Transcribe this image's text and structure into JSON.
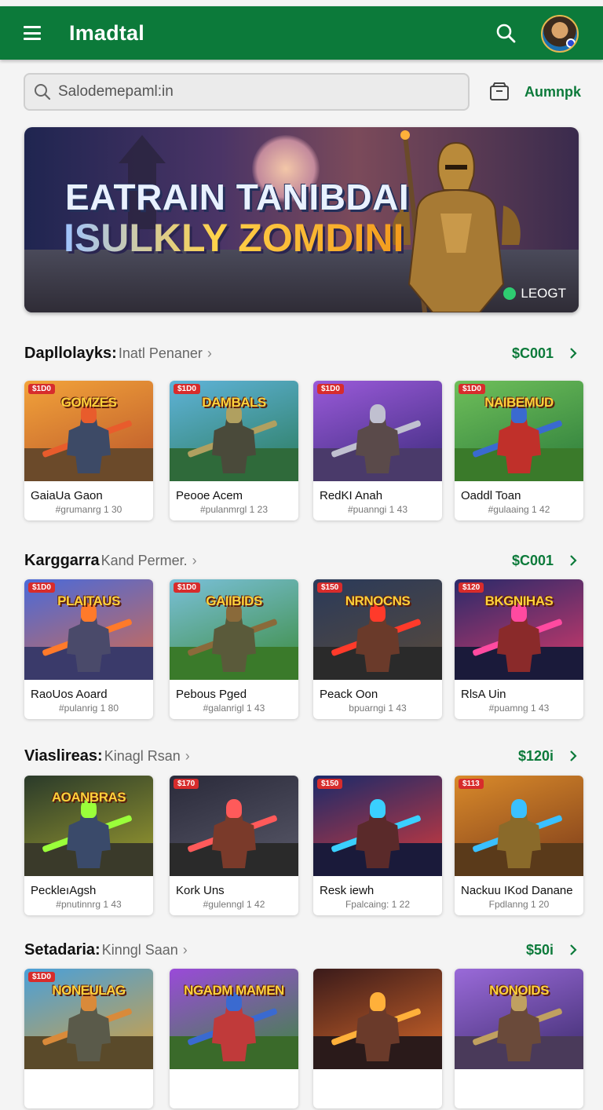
{
  "app": {
    "title": "Imadtal"
  },
  "search": {
    "placeholder": "Salodemepaml:in",
    "action_label": "Aumnpk"
  },
  "banner": {
    "line1": "EATRAIN TANIBDAI",
    "line2": "ISULKLY ZOMDINI",
    "brand": "LEOGT"
  },
  "sections": [
    {
      "title": "Dapllolayks:",
      "subtitle": "Inatl Penaner",
      "price": "$C001",
      "items": [
        {
          "tag": "$1D0",
          "art_title": "GOMZES",
          "name": "GaiaUa Gaon",
          "meta": "#grumanrg 1 30",
          "sky": [
            "#f2a33a",
            "#b9542a"
          ],
          "ground": "#6b4a2a",
          "hero": "#3d4a66",
          "accent": "#e85c2c"
        },
        {
          "tag": "$1D0",
          "art_title": "DAMBALS",
          "name": "Peooe Acem",
          "meta": "#pulanmrgl 1 23",
          "sky": [
            "#5fb3d9",
            "#2a7a5a"
          ],
          "ground": "#2f6a3a",
          "hero": "#4a4a3a",
          "accent": "#b0a060"
        },
        {
          "tag": "$1D0",
          "art_title": "",
          "name": "RedKI Anah",
          "meta": "#puanngi 1 43",
          "sky": [
            "#9a5ad9",
            "#3a2a7a"
          ],
          "ground": "#4a3a6a",
          "hero": "#5a4a4a",
          "accent": "#c0c0d0"
        },
        {
          "tag": "$1D0",
          "art_title": "NAIBEMUD",
          "name": "Oaddl Toan",
          "meta": "#gulaaing 1 42",
          "sky": [
            "#6fbf5a",
            "#2a7a3a"
          ],
          "ground": "#3a7a2a",
          "hero": "#c0302a",
          "accent": "#3a6ad0"
        }
      ]
    },
    {
      "title": "Karggarra",
      "subtitle": "Kand Permer.",
      "price": "$C001",
      "items": [
        {
          "tag": "$1D0",
          "art_title": "PLAITAUS",
          "name": "RaoUos Aoard",
          "meta": "#pulanrig 1 80",
          "sky": [
            "#4a6ad9",
            "#d96a4a"
          ],
          "ground": "#3a3a6a",
          "hero": "#4a4a6a",
          "accent": "#ff7a2a"
        },
        {
          "tag": "$1D0",
          "art_title": "GAIIBIDS",
          "name": "Pebous Pged",
          "meta": "#galanrigl 1 43",
          "sky": [
            "#7ac0d9",
            "#3a8a3a"
          ],
          "ground": "#3a7a2a",
          "hero": "#5a5a3a",
          "accent": "#8a6a3a"
        },
        {
          "tag": "$150",
          "art_title": "NRNOCNS",
          "name": "Peack Oon",
          "meta": "bpuarngi 1 43",
          "sky": [
            "#2a3a5a",
            "#5a4a3a"
          ],
          "ground": "#2a2a2a",
          "hero": "#6a3a2a",
          "accent": "#ff3a2a"
        },
        {
          "tag": "$120",
          "art_title": "BKGNIHAS",
          "name": "RlsA Uin",
          "meta": "#puamng 1 43",
          "sky": [
            "#2a2a6a",
            "#d93a6a"
          ],
          "ground": "#1a1a3a",
          "hero": "#8a2a2a",
          "accent": "#ff4aa0"
        }
      ]
    },
    {
      "title": "Viaslireas:",
      "subtitle": "Kinagl Rsan",
      "price": "$120i",
      "items": [
        {
          "tag": "",
          "art_title": "AOANBRAS",
          "name": "PeckleıAgsh",
          "meta": "#pnutinnrg 1 43",
          "sky": [
            "#2a3a2a",
            "#a0a030"
          ],
          "ground": "#3a3a2a",
          "hero": "#3a4a6a",
          "accent": "#9aff3a"
        },
        {
          "tag": "$170",
          "art_title": "",
          "name": "Kork Uns",
          "meta": "#gulenngl 1 42",
          "sky": [
            "#2a2a3a",
            "#5a5a6a"
          ],
          "ground": "#2a2a2a",
          "hero": "#7a3a2a",
          "accent": "#ff5a5a"
        },
        {
          "tag": "$150",
          "art_title": "",
          "name": "Resk iewh",
          "meta": "Fpalcaing: 1 22",
          "sky": [
            "#1a2a6a",
            "#d93a3a"
          ],
          "ground": "#1a1a3a",
          "hero": "#5a2a2a",
          "accent": "#3ad0ff"
        },
        {
          "tag": "$113",
          "art_title": "",
          "name": "Nackuu IKod Danane",
          "meta": "Fpdlanng 1 20",
          "sky": [
            "#d98a2a",
            "#7a3a1a"
          ],
          "ground": "#5a3a1a",
          "hero": "#8a6a2a",
          "accent": "#3ac0ff"
        }
      ]
    },
    {
      "title": "Setadaria:",
      "subtitle": "Kinngl Saan",
      "price": "$50i",
      "items": [
        {
          "tag": "$1D0",
          "art_title": "NONEULAG",
          "name": "",
          "meta": "",
          "sky": [
            "#4aa0d9",
            "#d9a03a"
          ],
          "ground": "#5a4a2a",
          "hero": "#5a5a4a",
          "accent": "#d98a3a"
        },
        {
          "tag": "",
          "art_title": "NGADM MAMEN",
          "name": "",
          "meta": "",
          "sky": [
            "#9a4ad9",
            "#3a8a3a"
          ],
          "ground": "#3a6a2a",
          "hero": "#c03a3a",
          "accent": "#3a6ad0"
        },
        {
          "tag": "",
          "art_title": "",
          "name": "",
          "meta": "",
          "sky": [
            "#3a1a1a",
            "#d96a2a"
          ],
          "ground": "#2a1a1a",
          "hero": "#6a3a2a",
          "accent": "#ffb03a"
        },
        {
          "tag": "",
          "art_title": "NONOIDS",
          "name": "",
          "meta": "",
          "sky": [
            "#9a6ad9",
            "#3a2a6a"
          ],
          "ground": "#4a3a5a",
          "hero": "#6a4a3a",
          "accent": "#c0a060"
        }
      ]
    }
  ]
}
